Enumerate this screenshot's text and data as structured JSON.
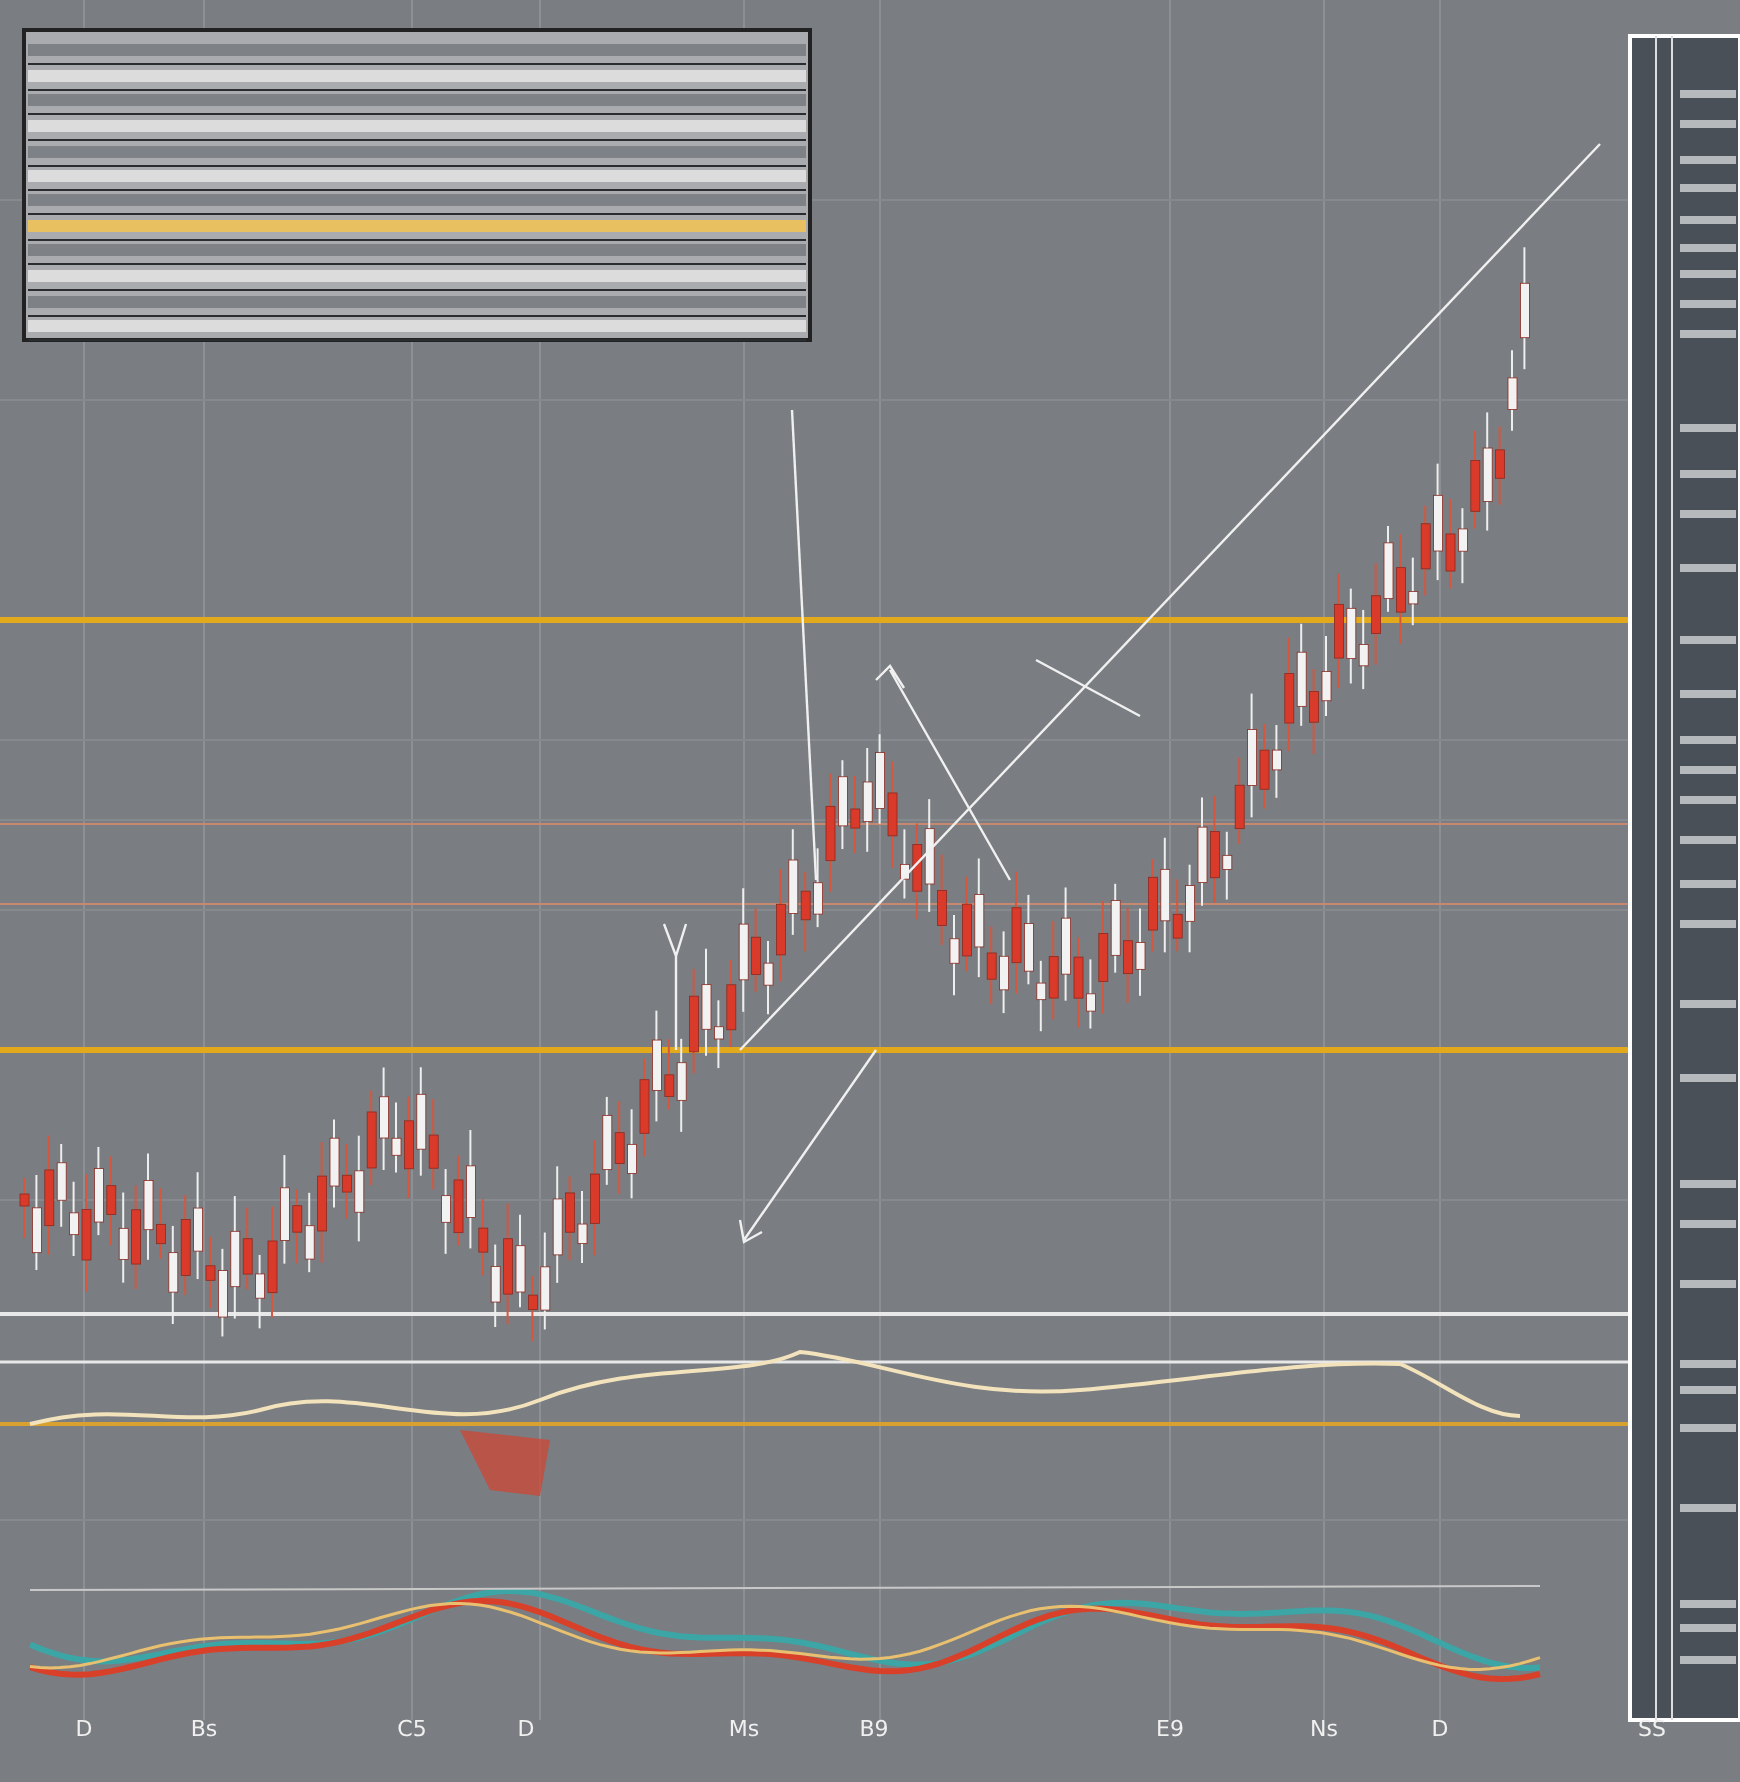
{
  "x_axis": {
    "labels": [
      "D",
      "Bs",
      "C5",
      "D",
      "Ms",
      "B9",
      "E9",
      "Ns",
      "D",
      "SS"
    ]
  }
}
